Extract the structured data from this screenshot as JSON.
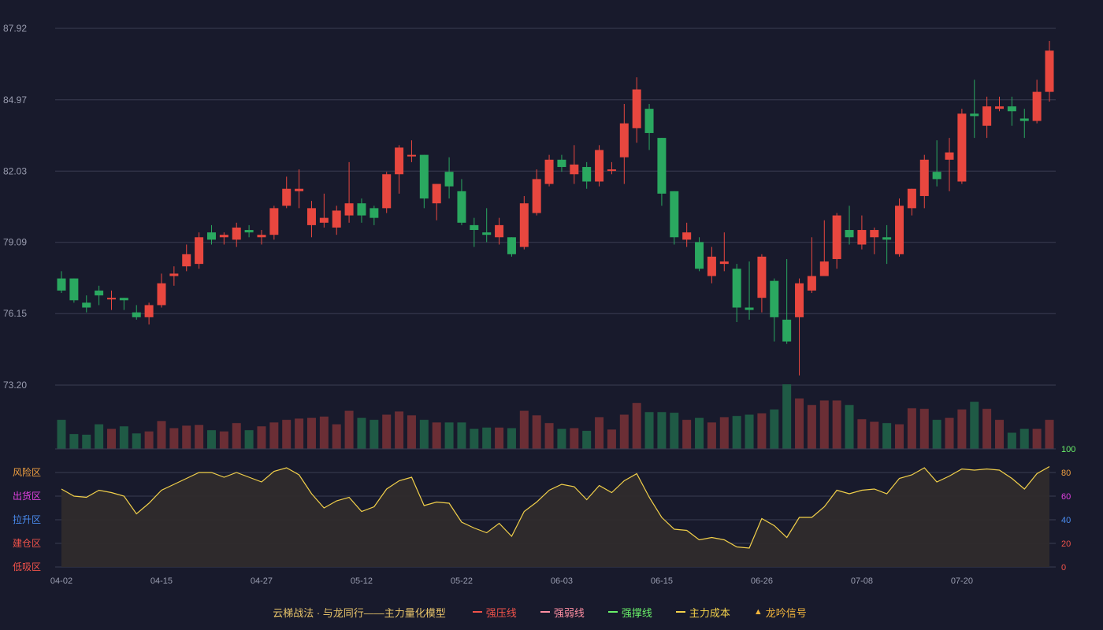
{
  "legend": {
    "title": "云梯战法 · 与龙同行——主力量化模型",
    "items": [
      {
        "label": "强压线",
        "color": "#f0524a",
        "style": "solid"
      },
      {
        "label": "强弱线",
        "color": "#ff8fa3",
        "style": "dashed"
      },
      {
        "label": "强撑线",
        "color": "#69f069",
        "style": "solid"
      },
      {
        "label": "主力成本",
        "color": "#f2d04a",
        "style": "dashed"
      },
      {
        "label": "龙吟信号",
        "color": "#f0b43c",
        "style": "triangle"
      }
    ]
  },
  "chart_data": [
    {
      "type": "candlestick",
      "y_ticks": [
        "73.20",
        "76.15",
        "79.09",
        "82.03",
        "84.97",
        "87.92"
      ],
      "ylim": [
        73.2,
        87.92
      ],
      "x_tick_labels": [
        "04-02",
        "04-15",
        "04-27",
        "05-12",
        "05-22",
        "06-03",
        "06-15",
        "06-26",
        "07-08",
        "07-20"
      ],
      "x_tick_indices": [
        0,
        8,
        16,
        24,
        32,
        40,
        48,
        56,
        64,
        72
      ],
      "up_color": "#e8473f",
      "down_color": "#2aa860",
      "candles": [
        [
          77.6,
          77.1,
          77.9,
          77.0
        ],
        [
          77.6,
          76.7,
          77.6,
          76.6
        ],
        [
          76.6,
          76.4,
          76.9,
          76.2
        ],
        [
          77.1,
          76.9,
          77.3,
          76.5
        ],
        [
          76.8,
          76.8,
          77.1,
          76.3
        ],
        [
          76.8,
          76.7,
          76.8,
          76.3
        ],
        [
          76.2,
          76.0,
          76.5,
          75.9
        ],
        [
          76.0,
          76.5,
          76.6,
          75.7
        ],
        [
          76.5,
          77.4,
          77.8,
          76.4
        ],
        [
          77.7,
          77.8,
          78.1,
          77.3
        ],
        [
          78.1,
          78.6,
          79.0,
          77.9
        ],
        [
          78.2,
          79.3,
          79.5,
          78.0
        ],
        [
          79.5,
          79.2,
          79.8,
          79.0
        ],
        [
          79.3,
          79.4,
          79.5,
          79.0
        ],
        [
          79.2,
          79.7,
          79.9,
          78.9
        ],
        [
          79.6,
          79.5,
          79.8,
          79.3
        ],
        [
          79.3,
          79.4,
          79.6,
          79.0
        ],
        [
          79.4,
          80.5,
          80.6,
          79.2
        ],
        [
          80.6,
          81.3,
          81.8,
          80.5
        ],
        [
          81.2,
          81.3,
          82.1,
          80.5
        ],
        [
          79.8,
          80.5,
          80.8,
          79.3
        ],
        [
          79.9,
          80.1,
          81.1,
          79.7
        ],
        [
          79.7,
          80.4,
          80.6,
          79.4
        ],
        [
          80.2,
          80.7,
          82.4,
          79.9
        ],
        [
          80.7,
          80.2,
          80.9,
          79.9
        ],
        [
          80.5,
          80.1,
          80.6,
          79.8
        ],
        [
          80.5,
          81.9,
          82.0,
          80.3
        ],
        [
          81.9,
          83.0,
          83.1,
          81.1
        ],
        [
          82.7,
          82.7,
          83.3,
          82.4
        ],
        [
          82.7,
          80.9,
          82.7,
          80.5
        ],
        [
          80.7,
          81.5,
          81.5,
          80.0
        ],
        [
          82.0,
          81.4,
          82.6,
          80.9
        ],
        [
          81.2,
          79.9,
          81.7,
          79.8
        ],
        [
          79.8,
          79.6,
          80.1,
          78.9
        ],
        [
          79.5,
          79.4,
          80.5,
          79.1
        ],
        [
          79.3,
          79.8,
          80.1,
          79.0
        ],
        [
          79.3,
          78.6,
          79.3,
          78.5
        ],
        [
          78.9,
          80.7,
          81.0,
          78.8
        ],
        [
          80.3,
          81.7,
          82.1,
          80.2
        ],
        [
          81.5,
          82.5,
          82.7,
          81.4
        ],
        [
          82.5,
          82.2,
          82.7,
          82.0
        ],
        [
          81.9,
          82.3,
          83.1,
          81.5
        ],
        [
          82.2,
          81.6,
          82.4,
          81.3
        ],
        [
          81.6,
          82.9,
          83.1,
          81.4
        ],
        [
          82.1,
          82.1,
          82.4,
          81.9
        ],
        [
          82.6,
          84.0,
          84.8,
          81.5
        ],
        [
          83.8,
          85.4,
          85.9,
          83.2
        ],
        [
          84.6,
          83.6,
          84.8,
          82.9
        ],
        [
          83.4,
          81.1,
          83.4,
          80.6
        ],
        [
          81.2,
          79.3,
          81.2,
          79.0
        ],
        [
          79.2,
          79.5,
          79.9,
          78.9
        ],
        [
          79.1,
          78.0,
          79.3,
          77.9
        ],
        [
          77.7,
          78.5,
          78.9,
          77.4
        ],
        [
          78.2,
          78.3,
          79.5,
          77.9
        ],
        [
          78.0,
          76.4,
          78.2,
          75.8
        ],
        [
          76.4,
          76.3,
          78.3,
          75.9
        ],
        [
          76.8,
          78.5,
          78.6,
          76.2
        ],
        [
          77.5,
          76.0,
          77.6,
          75.0
        ],
        [
          75.9,
          75.0,
          78.4,
          74.9
        ],
        [
          76.0,
          77.4,
          77.6,
          73.6
        ],
        [
          77.1,
          77.7,
          79.3,
          77.0
        ],
        [
          77.7,
          78.3,
          80.0,
          78.2
        ],
        [
          78.4,
          80.2,
          80.3,
          78.0
        ],
        [
          79.6,
          79.3,
          80.6,
          79.0
        ],
        [
          79.0,
          79.6,
          80.2,
          78.8
        ],
        [
          79.3,
          79.6,
          79.7,
          78.6
        ],
        [
          79.3,
          79.2,
          79.8,
          78.2
        ],
        [
          78.6,
          80.6,
          80.9,
          78.5
        ],
        [
          80.5,
          81.3,
          81.3,
          80.2
        ],
        [
          81.0,
          82.5,
          82.7,
          80.5
        ],
        [
          82.0,
          81.7,
          83.3,
          81.4
        ],
        [
          82.5,
          82.8,
          83.4,
          81.2
        ],
        [
          81.6,
          84.4,
          84.6,
          81.5
        ],
        [
          84.4,
          84.3,
          85.8,
          83.4
        ],
        [
          83.9,
          84.7,
          85.1,
          83.4
        ],
        [
          84.6,
          84.7,
          85.1,
          84.5
        ],
        [
          84.7,
          84.5,
          85.1,
          83.9
        ],
        [
          84.2,
          84.1,
          84.6,
          83.4
        ],
        [
          84.1,
          85.3,
          85.8,
          84.0
        ],
        [
          85.3,
          87.0,
          87.4,
          84.9
        ]
      ],
      "volume_ratio": [
        0.45,
        0.23,
        0.22,
        0.38,
        0.31,
        0.35,
        0.24,
        0.27,
        0.43,
        0.32,
        0.36,
        0.37,
        0.29,
        0.27,
        0.4,
        0.29,
        0.35,
        0.41,
        0.45,
        0.47,
        0.48,
        0.5,
        0.38,
        0.59,
        0.48,
        0.45,
        0.53,
        0.58,
        0.52,
        0.45,
        0.41,
        0.41,
        0.41,
        0.31,
        0.33,
        0.33,
        0.32,
        0.59,
        0.52,
        0.4,
        0.31,
        0.32,
        0.28,
        0.49,
        0.3,
        0.53,
        0.71,
        0.57,
        0.57,
        0.56,
        0.45,
        0.48,
        0.41,
        0.49,
        0.51,
        0.53,
        0.55,
        0.61,
        1.0,
        0.78,
        0.68,
        0.75,
        0.75,
        0.68,
        0.46,
        0.42,
        0.4,
        0.38,
        0.63,
        0.62,
        0.45,
        0.48,
        0.61,
        0.73,
        0.62,
        0.45,
        0.25,
        0.31,
        0.31,
        0.45
      ]
    },
    {
      "type": "area",
      "ylim": [
        0,
        100
      ],
      "y_ticks": [
        "0",
        "20",
        "40",
        "60",
        "80",
        "100"
      ],
      "y_tick_colors": [
        "#f0524a",
        "#f0524a",
        "#4a8cf0",
        "#e040e0",
        "#f0a040",
        "#69f069"
      ],
      "zones": [
        {
          "label": "低吸区",
          "color": "#f0524a"
        },
        {
          "label": "建仓区",
          "color": "#f0524a"
        },
        {
          "label": "拉升区",
          "color": "#4a8cf0"
        },
        {
          "label": "出货区",
          "color": "#e040e0"
        },
        {
          "label": "风险区",
          "color": "#f0a040"
        }
      ],
      "line_color": "#f2d04a",
      "values": [
        66,
        60,
        59,
        65,
        63,
        60,
        45,
        54,
        65,
        70,
        75,
        80,
        80,
        76,
        80,
        76,
        72,
        81,
        84,
        78,
        62,
        50,
        56,
        59,
        47,
        51,
        66,
        73,
        76,
        52,
        55,
        54,
        38,
        33,
        29,
        37,
        26,
        47,
        55,
        65,
        70,
        68,
        57,
        69,
        63,
        73,
        79,
        59,
        42,
        32,
        31,
        23,
        25,
        23,
        17,
        16,
        41,
        35,
        25,
        42,
        42,
        51,
        65,
        62,
        65,
        66,
        62,
        75,
        78,
        84,
        72,
        77,
        83,
        82,
        83,
        82,
        75,
        66,
        79,
        85
      ]
    }
  ]
}
